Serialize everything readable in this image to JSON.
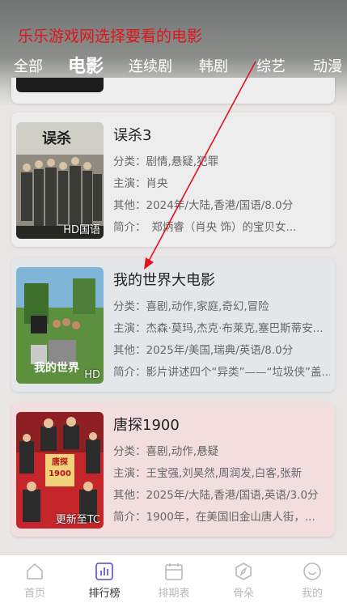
{
  "annotation": {
    "title": "乐乐游戏网选择要看的电影"
  },
  "tabs": [
    {
      "label": "全部"
    },
    {
      "label": "电影"
    },
    {
      "label": "连续剧"
    },
    {
      "label": "韩剧"
    },
    {
      "label": "综艺"
    },
    {
      "label": "动漫"
    }
  ],
  "active_tab": "电影",
  "movies": [
    {
      "title": "误杀3",
      "genre": "分类：剧情,悬疑,犯罪",
      "cast": "主演：肖央",
      "other": "其他：2024年/大陆,香港/国语/8.0分",
      "summary": "简介：　郑炳睿（肖央 饰）的宝贝女...",
      "badge": "HD国语",
      "poster_text": "误杀"
    },
    {
      "title": "我的世界大电影",
      "genre": "分类：喜剧,动作,家庭,奇幻,冒险",
      "cast": "主演：杰森·莫玛,杰克·布莱克,塞巴斯蒂安...",
      "other": "其他：2025年/美国,瑞典/英语/8.0分",
      "summary": "简介：影片讲述四个“异类”——“垃圾侠”盖...",
      "badge": "HD",
      "poster_text": "我的世界"
    },
    {
      "title": "唐探1900",
      "genre": "分类：喜剧,动作,悬疑",
      "cast": "主演：王宝强,刘昊然,周润发,白客,张新",
      "other": "其他：2025年/大陆,香港/国语,英语/3.0分",
      "summary": "简介：1900年，在美国旧金山唐人街，...",
      "badge": "更新至TC",
      "poster_text": "唐探1900"
    }
  ],
  "bottom_nav": [
    {
      "label": "首页",
      "icon": "home-icon"
    },
    {
      "label": "排行榜",
      "icon": "chart-icon"
    },
    {
      "label": "排期表",
      "icon": "calendar-icon"
    },
    {
      "label": "骨朵",
      "icon": "compass-icon"
    },
    {
      "label": "我的",
      "icon": "smile-icon"
    }
  ],
  "colors": {
    "annotation": "#e0141b",
    "nav_active": "#6b5fd1",
    "nav_inactive": "#b9b9b9"
  }
}
